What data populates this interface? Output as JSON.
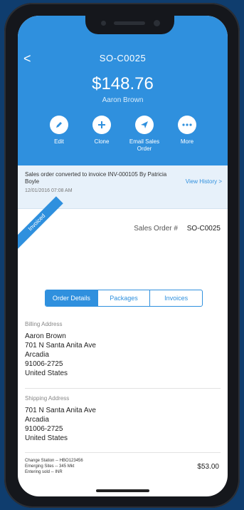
{
  "header": {
    "back": "<",
    "order_id": "SO-C0025",
    "amount": "$148.76",
    "customer": "Aaron Brown"
  },
  "actions": [
    {
      "label": "Edit",
      "icon": "pencil-icon"
    },
    {
      "label": "Clone",
      "icon": "plus-icon"
    },
    {
      "label": "Email Sales Order",
      "icon": "send-icon"
    },
    {
      "label": "More",
      "icon": "more-icon"
    }
  ],
  "activity": {
    "message": "Sales order converted to invoice INV-000105 By Patricia Boyle",
    "timestamp": "12/01/2016 07:08 AM",
    "link": "View History >"
  },
  "status_ribbon": "Invoiced",
  "sales_order": {
    "label": "Sales Order #",
    "number": "SO-C0025"
  },
  "tabs": [
    {
      "label": "Order Details",
      "active": true
    },
    {
      "label": "Packages",
      "active": false
    },
    {
      "label": "Invoices",
      "active": false
    }
  ],
  "billing": {
    "heading": "Billing Address",
    "lines": [
      "Aaron Brown",
      "701 N Santa Anita Ave",
      "Arcadia",
      "91006-2725",
      "United States"
    ]
  },
  "shipping": {
    "heading": "Shipping Address",
    "lines": [
      "701 N Santa Anita Ave",
      "Arcadia",
      "91006-2725",
      "United States"
    ]
  },
  "footer": {
    "notes": [
      "Change Station -- HBO123456",
      "Emerging Sites -- 345 Mkt",
      "Entering sold -- INR"
    ],
    "amount": "$53.00"
  },
  "colors": {
    "accent": "#2f90de",
    "background": "#0f3d6e"
  }
}
